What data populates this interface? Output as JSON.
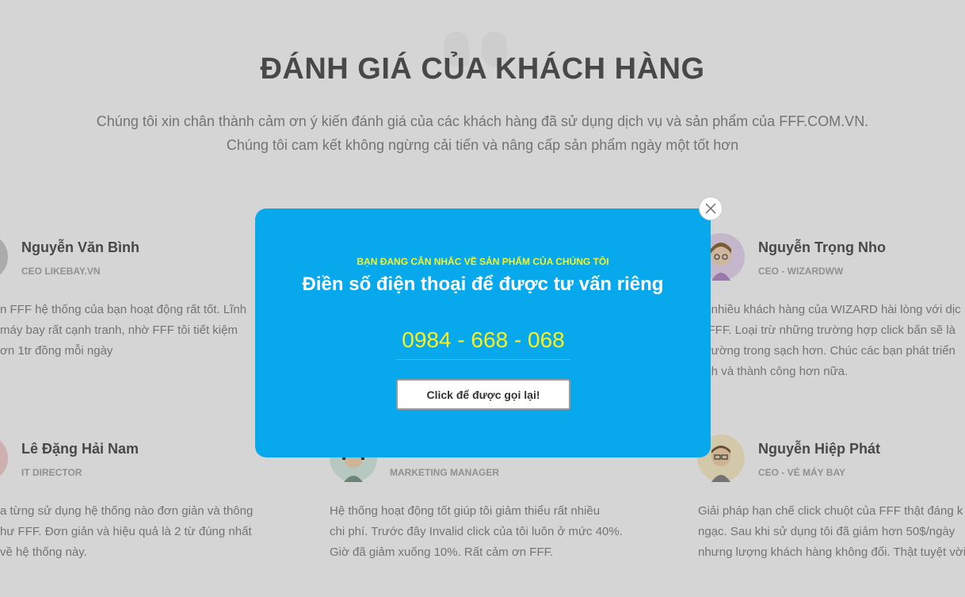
{
  "section": {
    "title": "ĐÁNH GIÁ CỦA KHÁCH HÀNG",
    "subtitle_line1": "Chúng tôi xin chân thành cảm ơn ý kiến đánh giá của các khách hàng đã sử dụng dịch vụ và sản phẩm của FFF.COM.VN.",
    "subtitle_line2": "Chúng tôi cam kết không ngừng cải tiến và nâng cấp sản phẩm ngày một tốt hơn"
  },
  "testimonials": [
    {
      "name": "Nguyễn Văn Bình",
      "role": "CEO LIKEBAY.VN",
      "text": "n FFF hệ thống của bạn hoạt động rất tốt. Lĩnh\nmáy bay rất cạnh tranh, nhờ FFF tôi tiết kiệm\nơn 1tr đồng mỗi ngày"
    },
    {
      "name": "Nguyễn Trọng Nho",
      "role": "CEO - WIZARDWW",
      "text": "ất nhiều khách hàng của WIZARD hài lòng với dịc\na FFF. Loại trừ những trường hợp click bấn sẽ là\ni trường trong sạch hơn. Chúc các bạn phát triển\nạnh và thành công hơn nữa."
    },
    {
      "name": "Lê Đặng Hải Nam",
      "role": "IT DIRECTOR",
      "text": "a từng sử dụng hệ thống nào đơn giản và thông\như FFF. Đơn giản và hiệu quả là 2 từ đúng nhất\nvề hệ thống này."
    },
    {
      "name": "",
      "role": "MARKETING MANAGER",
      "text": "Hệ thống hoạt động tốt giúp tôi giảm thiểu rất nhiều\nchi phí. Trước đây Invalid click của tôi luôn ở mức 40%.\nGiờ đã giảm xuống 10%. Rất cảm ơn FFF."
    },
    {
      "name": "Nguyễn Hiệp Phát",
      "role": "CEO - VÉ MÁY BAY",
      "text": "Giải pháp hạn chế click chuột của FFF thật đáng k\nngạc. Sau khi sử dụng tôi đã giảm hơn 50$/ngày\nnhưng lượng khách hàng không đổi. Thật tuyệt vời"
    }
  ],
  "modal": {
    "kicker": "BẠN ĐANG CÂN NHẮC VỀ SẢN PHẨM CỦA CHÚNG TÔI",
    "heading": "Điền số điện thoại để được tư vấn riêng",
    "phone": "0984 - 668 - 068",
    "button_label": "Click để được gọi lại!",
    "close_icon": "close-icon"
  },
  "colors": {
    "modal_bg": "#07a9ec",
    "accent_yellow": "#fbf11c",
    "overlay": "rgba(0,0,0,0.15)"
  }
}
